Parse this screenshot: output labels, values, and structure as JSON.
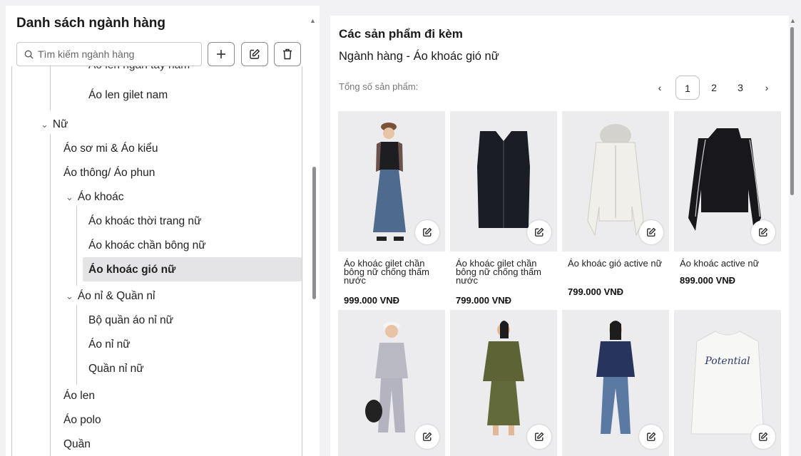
{
  "category_panel": {
    "title": "Danh sách ngành hàng",
    "search_placeholder": "Tìm kiếm ngành hàng",
    "add_icon": "plus-icon",
    "edit_icon": "edit-icon",
    "delete_icon": "trash-icon",
    "tree": {
      "partial_item": "Áo len ngắn tay nam",
      "gilet_nam": "Áo len gilet nam",
      "nu": "Nữ",
      "so_mi": "Áo sơ mi & Áo kiểu",
      "thong_phun": "Áo thông/ Áo phun",
      "ao_khoac": "Áo khoác",
      "khoac_thoi_trang": "Áo khoác thời trang nữ",
      "khoac_chan_bong": "Áo khoác chần bông nữ",
      "khoac_gio": "Áo khoác gió nữ",
      "ao_ni": "Áo nỉ & Quần nỉ",
      "bo_quan_ao_ni": "Bộ quần áo nỉ nữ",
      "ao_ni_nu": "Áo nỉ nữ",
      "quan_ni_nu": "Quần nỉ nữ",
      "ao_len": "Áo len",
      "ao_polo": "Áo polo",
      "quan": "Quần"
    }
  },
  "products_panel": {
    "title": "Các sản phẩm đi kèm",
    "subtitle": "Ngành hàng - Áo khoác gió nữ",
    "total_label": "Tổng số sản phẩm:",
    "pagination": {
      "prev": "‹",
      "pages": [
        "1",
        "2",
        "3"
      ],
      "next": "›",
      "current": "1"
    },
    "products": [
      {
        "name": "Áo khoác gilet chần bông nữ chống thấm nước",
        "price": "999.000 VNĐ"
      },
      {
        "name": "Áo khoác gilet chần bông nữ chống thấm nước",
        "price": "799.000 VNĐ"
      },
      {
        "name": "Áo khoác gió active nữ",
        "price": "799.000 VNĐ"
      },
      {
        "name": "Áo khoác active nữ",
        "price": "899.000 VNĐ"
      }
    ],
    "edit_icon": "edit-icon"
  }
}
